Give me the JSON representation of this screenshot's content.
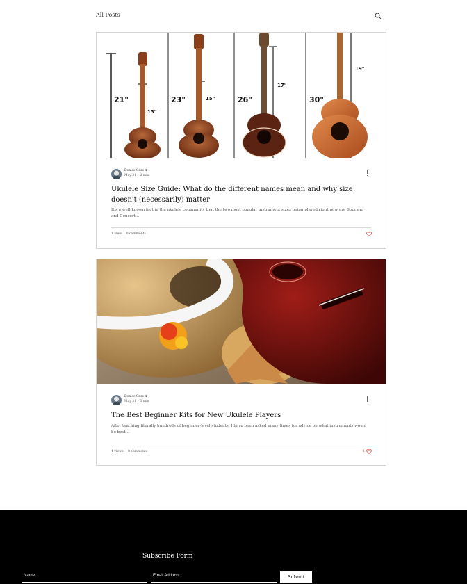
{
  "header": {
    "label": "All Posts"
  },
  "posts": [
    {
      "author": "Denise Case",
      "date": "May 31",
      "read_time": "2 min",
      "title": "Ukulele Size Guide: What do the different names mean and why size doesn't (necessarily) matter",
      "excerpt": "It's a well-known fact in the ukulele community that the two most popular instrument sizes being played right now are Soprano and Concert...",
      "views": "1 view",
      "comments": "0 comments",
      "likes": "",
      "image_labels": {
        "a": "21\"",
        "b": "13\"",
        "c": "23\"",
        "d": "15\"",
        "e": "26\"",
        "f": "17\"",
        "g": "30\"",
        "h": "19\""
      }
    },
    {
      "author": "Denise Case",
      "date": "May 31",
      "read_time": "3 min",
      "title": "The Best Beginner Kits for New Ukulele Players",
      "excerpt": "After teaching literally hundreds of beginner-level students, I have been asked many times for advice on what instruments would be best...",
      "views": "4 views",
      "comments": "0 comments",
      "likes": "1"
    }
  ],
  "footer": {
    "title": "Subscribe Form",
    "name_placeholder": "Name",
    "email_placeholder": "Email Address",
    "submit_label": "Submit"
  },
  "colors": {
    "accent": "#e04a3f",
    "footer_bg": "#000000",
    "border": "#d6d6d6"
  }
}
